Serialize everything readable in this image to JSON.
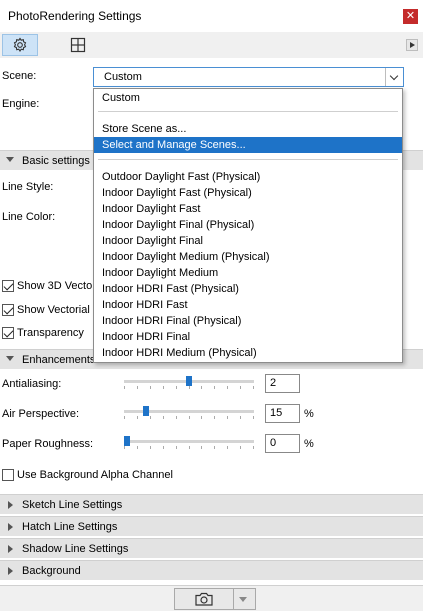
{
  "window": {
    "title": "PhotoRendering Settings",
    "close_glyph": "✕"
  },
  "toolbar": {
    "tabs": [
      {
        "name": "settings-tab",
        "icon": "gear-icon",
        "active": true
      },
      {
        "name": "preview-tab",
        "icon": "grid-icon",
        "active": false
      }
    ],
    "overflow_icon": "chevron-right-icon"
  },
  "scene": {
    "label": "Scene:",
    "value": "Custom"
  },
  "engine": {
    "label": "Engine:"
  },
  "dropdown": {
    "items": [
      {
        "label": "Custom",
        "highlighted": false
      },
      {
        "label": "Store Scene as...",
        "highlighted": false
      },
      {
        "label": "Select and Manage Scenes...",
        "highlighted": true
      },
      {
        "label": "Outdoor Daylight Fast (Physical)",
        "highlighted": false
      },
      {
        "label": "Indoor Daylight Fast (Physical)",
        "highlighted": false
      },
      {
        "label": "Indoor Daylight Fast",
        "highlighted": false
      },
      {
        "label": "Indoor Daylight Final (Physical)",
        "highlighted": false
      },
      {
        "label": "Indoor Daylight Final",
        "highlighted": false
      },
      {
        "label": "Indoor Daylight Medium (Physical)",
        "highlighted": false
      },
      {
        "label": "Indoor Daylight Medium",
        "highlighted": false
      },
      {
        "label": "Indoor HDRI Fast (Physical)",
        "highlighted": false
      },
      {
        "label": "Indoor HDRI Fast",
        "highlighted": false
      },
      {
        "label": "Indoor HDRI Final (Physical)",
        "highlighted": false
      },
      {
        "label": "Indoor HDRI Final",
        "highlighted": false
      },
      {
        "label": "Indoor HDRI Medium (Physical)",
        "highlighted": false
      }
    ]
  },
  "basic": {
    "title": "Basic settings",
    "line_style_label": "Line Style:",
    "line_color_label": "Line Color:",
    "show_3d_label": "Show 3D Vecto",
    "show_vectorial_label": "Show Vectorial",
    "transparency_label": "Transparency"
  },
  "enhancements": {
    "title": "Enhancements",
    "antialiasing": {
      "label": "Antialiasing:",
      "value": "2",
      "unit": "",
      "level": 0.5
    },
    "air_perspective": {
      "label": "Air Perspective:",
      "value": "15",
      "unit": "%",
      "level": 0.15
    },
    "paper_roughness": {
      "label": "Paper Roughness:",
      "value": "0",
      "unit": "%",
      "level": 0.0
    },
    "bg_alpha_label": "Use Background Alpha Channel"
  },
  "collapsed_sections": [
    {
      "title": "Sketch Line Settings"
    },
    {
      "title": "Hatch Line Settings"
    },
    {
      "title": "Shadow Line Settings"
    },
    {
      "title": "Background"
    }
  ],
  "footer": {
    "icon": "camera-icon"
  },
  "colors": {
    "accent": "#1e73c8",
    "close": "#c42b2b"
  }
}
